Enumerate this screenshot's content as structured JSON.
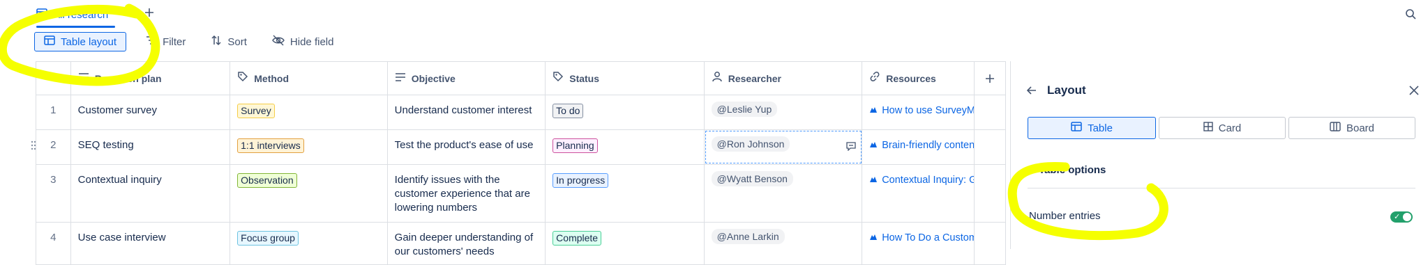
{
  "view_tab": {
    "label": "All research"
  },
  "toolbar": {
    "table_layout": "Table layout",
    "filter": "Filter",
    "sort": "Sort",
    "hide_field": "Hide field"
  },
  "table": {
    "columns": [
      "Research plan",
      "Method",
      "Objective",
      "Status",
      "Researcher",
      "Resources"
    ],
    "rows": [
      {
        "num": "1",
        "plan": "Customer survey",
        "method": "Survey",
        "objective": "Understand customer interest",
        "status": "To do",
        "researcher": "@Leslie Yup",
        "resource": "How to use SurveyMonkey"
      },
      {
        "num": "2",
        "plan": "SEQ testing",
        "method": "1:1 interviews",
        "objective": "Test the product's ease of use",
        "status": "Planning",
        "researcher": "@Ron Johnson",
        "resource": "Brain-friendly content to"
      },
      {
        "num": "3",
        "plan": "Contextual inquiry",
        "method": "Observation",
        "objective": "Identify issues with the customer experience that are lowering numbers",
        "status": "In progress",
        "researcher": "@Wyatt Benson",
        "resource": "Contextual Inquiry: Get T"
      },
      {
        "num": "4",
        "plan": "Use case interview",
        "method": "Focus group",
        "objective": "Gain deeper understanding of our customers' needs",
        "status": "Complete",
        "researcher": "@Anne Larkin",
        "resource": "How To Do a Customer I"
      }
    ]
  },
  "panel": {
    "title": "Layout",
    "options": [
      "Table",
      "Card",
      "Board"
    ],
    "section_title": "Table options",
    "number_entries_label": "Number entries",
    "number_entries_on": true
  },
  "colors": {
    "accent": "#0c66e4",
    "annotation_highlight": "#f5ff00",
    "toggle_on": "#22a06b"
  }
}
